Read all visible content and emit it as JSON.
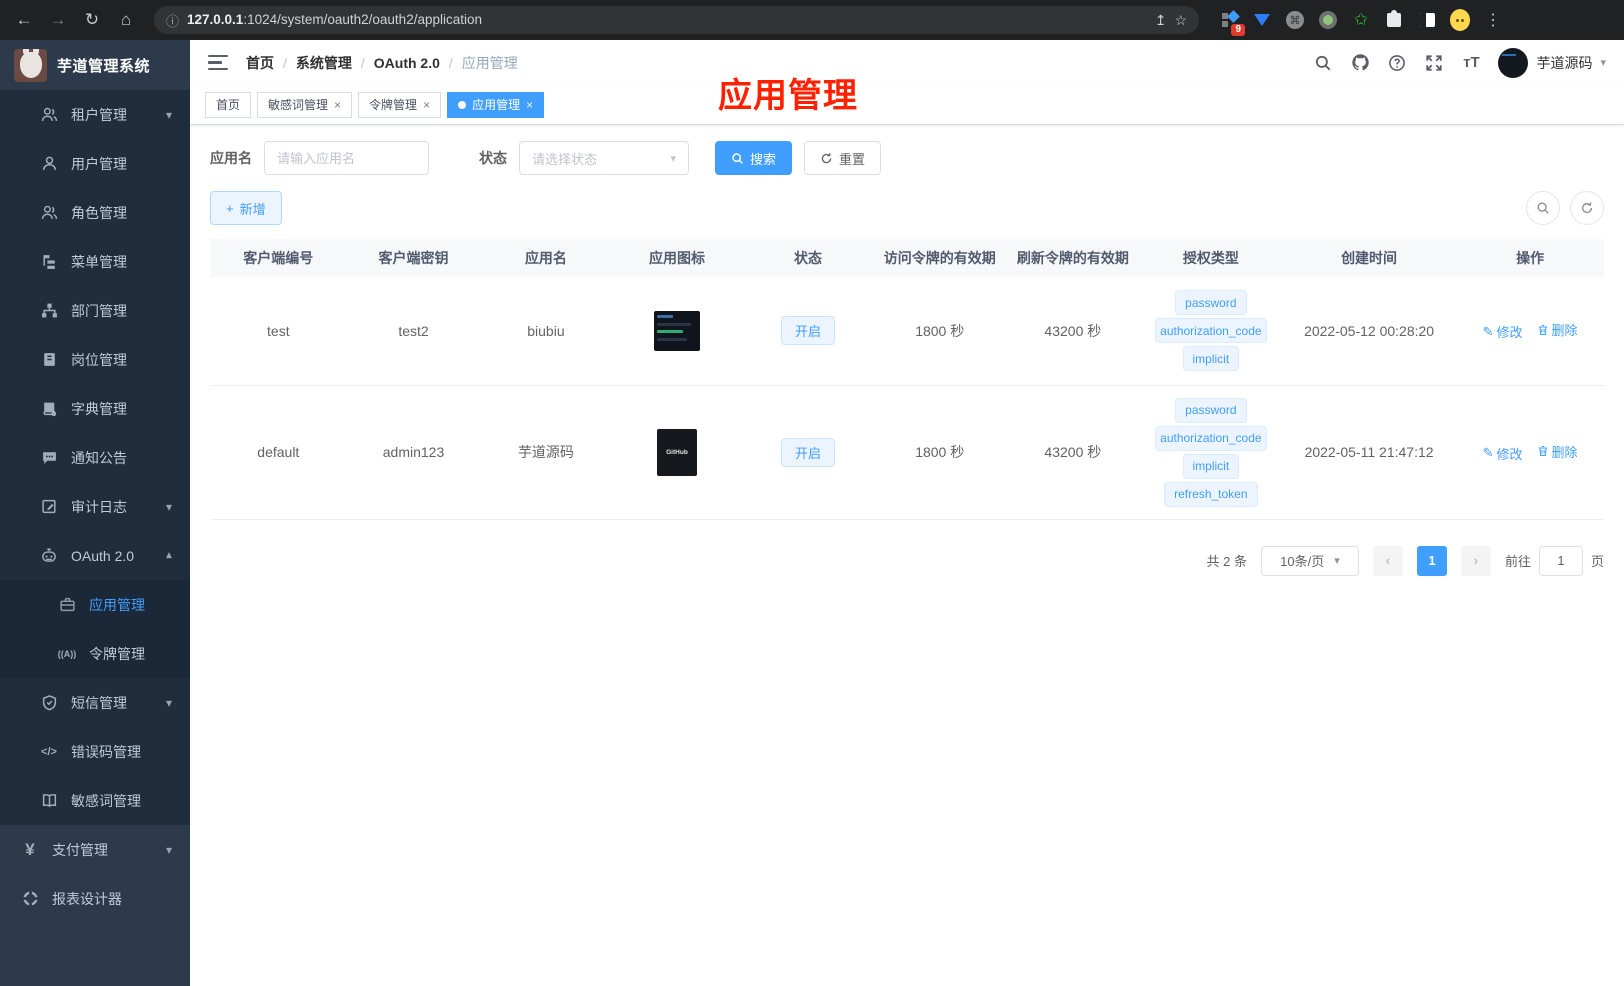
{
  "glyphs": {
    "back": "←",
    "forward": "→",
    "reload": "↻",
    "home": "⌂",
    "info": "ⓘ",
    "share": "↥",
    "star": "☆",
    "dots": "⋮",
    "slash": "/",
    "caret": "▾",
    "close": "×",
    "sel_caret": "▾",
    "prev": "‹",
    "next": "›",
    "cmd": "⌘",
    "font_size": "тT",
    "pencil": "✎",
    "plus": "+",
    "star_green": "✩"
  },
  "browser": {
    "url_host": "127.0.0.1",
    "url_rest": ":1024/system/oauth2/oauth2/application",
    "extension_badge": "9"
  },
  "sidebar": {
    "app_title": "芋道管理系统",
    "menu": [
      {
        "label": "租户管理"
      },
      {
        "label": "用户管理"
      },
      {
        "label": "角色管理"
      },
      {
        "label": "菜单管理"
      },
      {
        "label": "部门管理"
      },
      {
        "label": "岗位管理"
      },
      {
        "label": "字典管理"
      },
      {
        "label": "通知公告"
      },
      {
        "label": "审计日志"
      },
      {
        "label": "OAuth 2.0",
        "children": [
          {
            "label": "应用管理"
          },
          {
            "label": "令牌管理",
            "icon_glyph": "((A))"
          }
        ]
      },
      {
        "label": "短信管理"
      },
      {
        "label": "错误码管理",
        "icon_glyph": "</>"
      },
      {
        "label": "敏感词管理"
      },
      {
        "label": "支付管理",
        "icon_glyph": "¥"
      },
      {
        "label": "报表设计器"
      }
    ]
  },
  "header": {
    "breadcrumb": [
      "首页",
      "系统管理",
      "OAuth 2.0",
      "应用管理"
    ],
    "username": "芋道源码"
  },
  "overlay_title": "应用管理",
  "tabs": [
    {
      "label": "首页"
    },
    {
      "label": "敏感词管理"
    },
    {
      "label": "令牌管理"
    },
    {
      "label": "应用管理"
    }
  ],
  "filters": {
    "name_label": "应用名",
    "name_placeholder": "请输入应用名",
    "status_label": "状态",
    "status_placeholder": "请选择状态",
    "search_label": "搜索",
    "reset_label": "重置",
    "add_label": "新增"
  },
  "table": {
    "columns": [
      "客户端编号",
      "客户端密钥",
      "应用名",
      "应用图标",
      "状态",
      "访问令牌的有效期",
      "刷新令牌的有效期",
      "授权类型",
      "创建时间",
      "操作"
    ],
    "actions": {
      "edit": "修改",
      "delete": "删除"
    },
    "rows": [
      {
        "client_id": "test",
        "secret": "test2",
        "name": "biubiu",
        "status": "开启",
        "access_ttl": "1800 秒",
        "refresh_ttl": "43200 秒",
        "grants": [
          "password",
          "authorization_code",
          "implicit"
        ],
        "created": "2022-05-12 00:28:20"
      },
      {
        "client_id": "default",
        "secret": "admin123",
        "name": "芋道源码",
        "icon_label": "GitHub",
        "status": "开启",
        "access_ttl": "1800 秒",
        "refresh_ttl": "43200 秒",
        "grants": [
          "password",
          "authorization_code",
          "implicit",
          "refresh_token"
        ],
        "created": "2022-05-11 21:47:12"
      }
    ]
  },
  "pagination": {
    "total": "共 2 条",
    "page_size": "10条/页",
    "page": "1",
    "goto_prefix": "前往",
    "goto_suffix": "页",
    "goto_value": "1"
  }
}
